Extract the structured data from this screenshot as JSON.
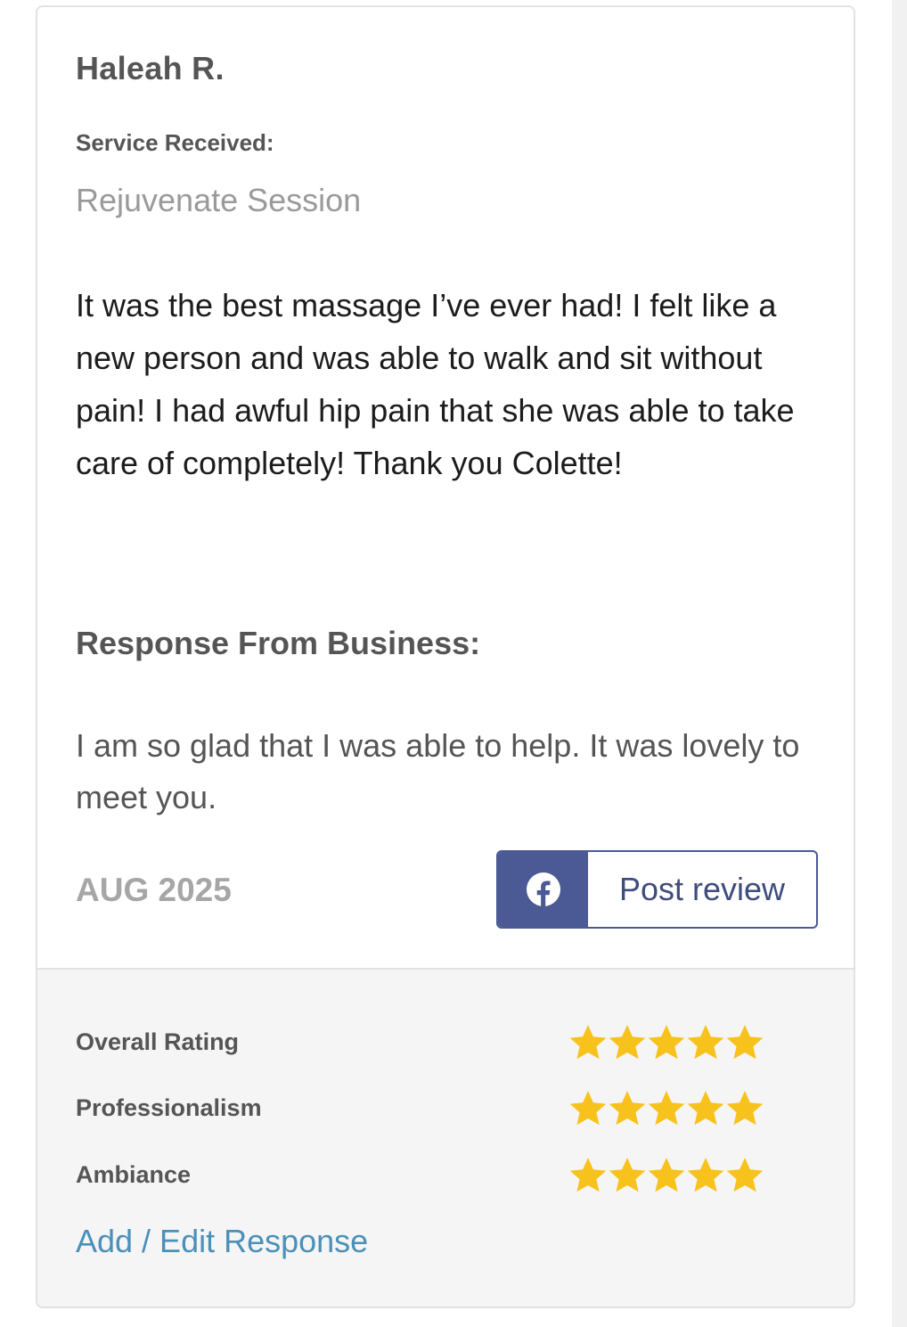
{
  "review": {
    "reviewer_name": "Haleah R.",
    "service_label": "Service Received:",
    "service_name": "Rejuvenate Session",
    "text": "It was the best massage I’ve ever had! I felt like a new person and was able to walk and sit without pain! I had awful hip pain that she was able to take care of completely! Thank you Colette!",
    "response_heading": "Response From Business:",
    "response_text": "I am so glad that I was able to help. It was lovely to meet you.",
    "date": "AUG 2025",
    "post_button": {
      "icon": "facebook-icon",
      "label": "Post review"
    }
  },
  "ratings": {
    "star_color": "#f7c21c",
    "max": 5,
    "items": [
      {
        "label": "Overall Rating",
        "stars": 5
      },
      {
        "label": "Professionalism",
        "stars": 5
      },
      {
        "label": "Ambiance",
        "stars": 5
      }
    ]
  },
  "actions": {
    "edit_response": "Add / Edit Response"
  },
  "colors": {
    "facebook_blue": "#4b5a94",
    "link_blue": "#4a90b8"
  }
}
